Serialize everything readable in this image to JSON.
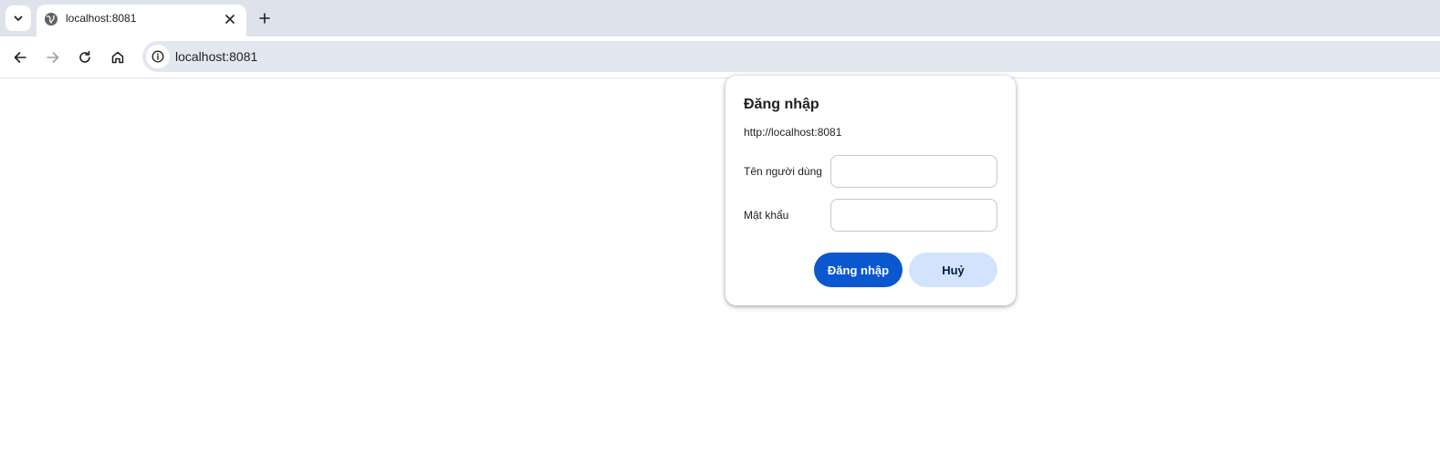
{
  "browser": {
    "tab": {
      "title": "localhost:8081",
      "favicon": "globe-icon",
      "close_icon": "close-icon"
    },
    "tab_search_icon": "chevron-down-icon",
    "new_tab_icon": "plus-icon",
    "nav": {
      "back_icon": "arrow-left-icon",
      "forward_icon": "arrow-right-icon",
      "reload_icon": "reload-icon",
      "home_icon": "home-icon"
    },
    "omnibox": {
      "site_info_icon": "info-icon",
      "url": "localhost:8081"
    }
  },
  "auth_dialog": {
    "title": "Đăng nhập",
    "origin": "http://localhost:8081",
    "username_label": "Tên người dùng",
    "username_value": "",
    "password_label": "Mật khẩu",
    "password_value": "",
    "submit_label": "Đăng nhập",
    "cancel_label": "Huỷ"
  },
  "colors": {
    "tabstrip_bg": "#dee3eb",
    "omnibox_bg": "#e3e8f0",
    "primary_button": "#0b57d0",
    "secondary_button": "#d3e3fd"
  }
}
